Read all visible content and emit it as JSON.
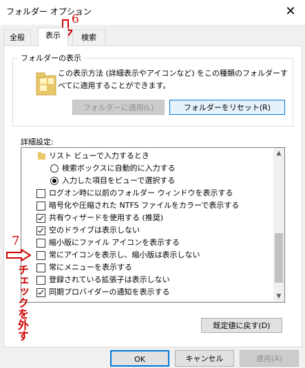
{
  "window": {
    "title": "フォルダー オプション",
    "close_glyph": "✕"
  },
  "annotations": {
    "tab_step": "6",
    "item_step": "7",
    "instruction": "チェックを外す"
  },
  "tabs": [
    {
      "label": "全般",
      "active": false
    },
    {
      "label": "表示",
      "active": true
    },
    {
      "label": "検索",
      "active": false
    }
  ],
  "folder_view": {
    "group_label": "フォルダーの表示",
    "description": "この表示方法 (詳細表示やアイコンなど) をこの種類のフォルダーすべてに適用することができます。",
    "apply_button": "フォルダーに適用(L)",
    "reset_button": "フォルダーをリセット(R)"
  },
  "advanced": {
    "label": "詳細設定:",
    "items": [
      {
        "type": "folder",
        "label": "リスト ビューで入力するとき"
      },
      {
        "type": "radio",
        "checked": false,
        "label": "検索ボックスに自動的に入力する"
      },
      {
        "type": "radio",
        "checked": true,
        "label": "入力した項目をビューで選択する"
      },
      {
        "type": "checkbox",
        "checked": false,
        "label": "ログオン時に以前のフォルダー ウィンドウを表示する"
      },
      {
        "type": "checkbox",
        "checked": false,
        "label": "暗号化や圧縮された NTFS ファイルをカラーで表示する"
      },
      {
        "type": "checkbox",
        "checked": true,
        "label": "共有ウィザードを使用する (推奨)"
      },
      {
        "type": "checkbox",
        "checked": true,
        "label": "空のドライブは表示しない"
      },
      {
        "type": "checkbox",
        "checked": false,
        "label": "縮小版にファイル アイコンを表示する"
      },
      {
        "type": "checkbox",
        "checked": false,
        "label": "常にアイコンを表示し、縮小版は表示しない"
      },
      {
        "type": "checkbox",
        "checked": false,
        "label": "常にメニューを表示する"
      },
      {
        "type": "checkbox",
        "checked": false,
        "label": "登録されている拡張子は表示しない"
      },
      {
        "type": "checkbox",
        "checked": true,
        "label": "同期プロバイダーの通知を表示する"
      }
    ],
    "restore_button": "既定値に戻す(D)"
  },
  "dialog_buttons": {
    "ok": "OK",
    "cancel": "キャンセル",
    "apply": "適用(A)"
  },
  "colors": {
    "accent": "#0078d7",
    "annotation": "#d00000"
  }
}
